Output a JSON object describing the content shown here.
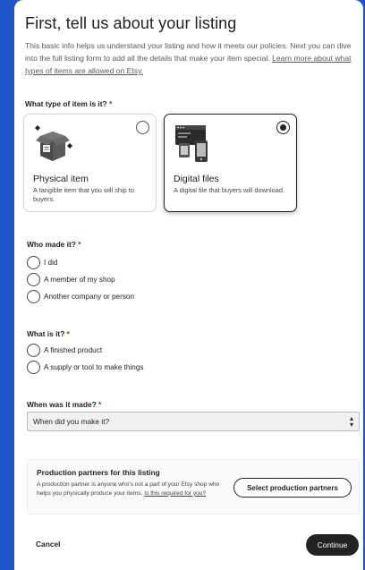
{
  "header": {
    "title": "First, tell us about your listing",
    "intro": "This basic info helps us understand your listing and how it meets our policies. Next you can dive into the full listing form to add all the details that make your item special.",
    "intro_link": "Learn more about what types of items are allowed on Etsy."
  },
  "item_type": {
    "label": "What type of item is it?",
    "required_mark": "*",
    "options": [
      {
        "title": "Physical item",
        "description": "A tangible item that you will ship to buyers.",
        "icon": "package-icon",
        "selected": false
      },
      {
        "title": "Digital files",
        "description": "A digital file that buyers will download.",
        "icon": "digital-files-icon",
        "selected": true
      }
    ]
  },
  "who_made": {
    "label": "Who made it?",
    "required_mark": "*",
    "options": [
      "I did",
      "A member of my shop",
      "Another company or person"
    ]
  },
  "what_is": {
    "label": "What is it?",
    "required_mark": "*",
    "options": [
      "A finished product",
      "A supply or tool to make things"
    ]
  },
  "when_made": {
    "label": "When was it made?",
    "required_mark": "*",
    "selected": "When did you make it?"
  },
  "partners": {
    "title": "Production partners for this listing",
    "description": "A production partner is anyone who's not a part of your Etsy shop who helps you physically produce your items.",
    "link": "Is this required for you?",
    "button": "Select production partners"
  },
  "footer": {
    "cancel": "Cancel",
    "continue": "Continue"
  },
  "colors": {
    "accent": "#222222",
    "required": "#b3261e",
    "frame": "#1f5fd6"
  }
}
